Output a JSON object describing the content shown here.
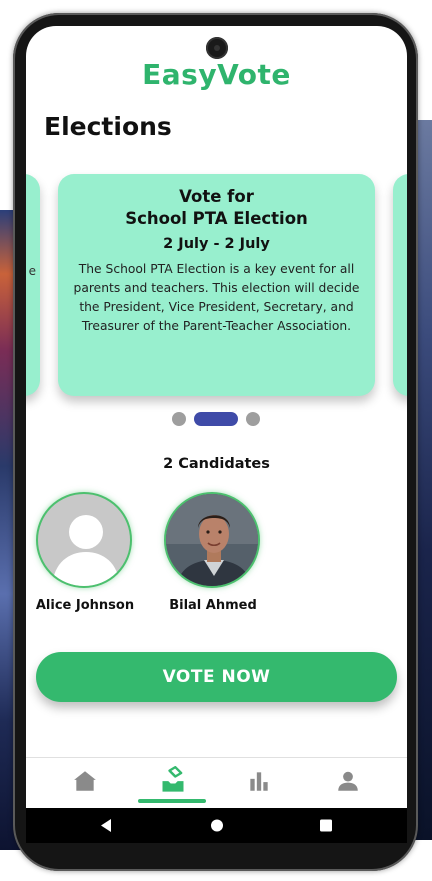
{
  "app": {
    "title": "EasyVote"
  },
  "page": {
    "title": "Elections"
  },
  "election_card": {
    "title_line1": "Vote for",
    "title_line2": "School PTA Election",
    "dates": "2 July  - 2 July",
    "description": "The School PTA Election is a key event for all parents and teachers. This election will decide the President, Vice President, Secretary, and Treasurer of the Parent-Teacher Association."
  },
  "carousel": {
    "pages": 3,
    "active_index": 1
  },
  "candidates": {
    "heading": "2 Candidates",
    "list": [
      {
        "name": "Alice Johnson",
        "avatar": "placeholder-person-icon"
      },
      {
        "name": "Bilal Ahmed",
        "avatar": "photo"
      }
    ]
  },
  "vote_button": {
    "label": "VOTE NOW"
  },
  "bottom_nav": {
    "items": [
      {
        "name": "home",
        "icon": "home-icon",
        "active": false
      },
      {
        "name": "vote",
        "icon": "ballot-icon",
        "active": true
      },
      {
        "name": "results",
        "icon": "bar-chart-icon",
        "active": false
      },
      {
        "name": "profile",
        "icon": "person-icon",
        "active": false
      }
    ]
  },
  "colors": {
    "brand_green": "#2fb46d",
    "card_mint": "#98efce",
    "active_dot": "#3f4ba8",
    "inactive_icon": "#8a8a8a"
  }
}
